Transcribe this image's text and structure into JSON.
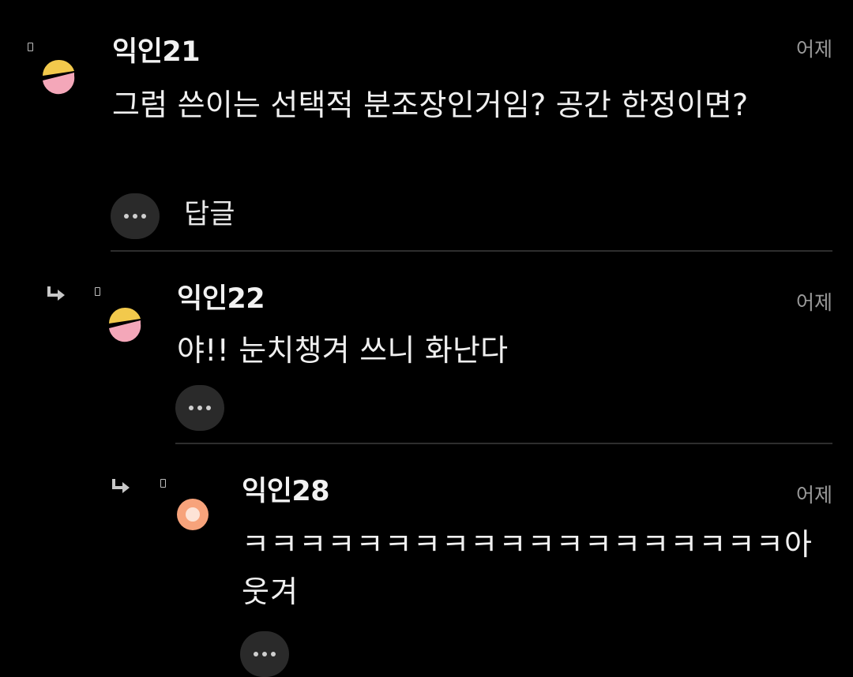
{
  "comments": [
    {
      "author": "익인21",
      "time": "어제",
      "text": "그럼 쓴이는 선택적 분조장인거임? 공간 한정이면?",
      "reply_label": "답글",
      "avatar_icon": "split-circle-yellow-pink"
    },
    {
      "author": "익인22",
      "time": "어제",
      "text": "야!! 눈치챙겨 쓰니 화난다",
      "avatar_icon": "split-circle-yellow-pink"
    },
    {
      "author": "익인28",
      "time": "어제",
      "text": "ㅋㅋㅋㅋㅋㅋㅋㅋㅋㅋㅋㅋㅋㅋㅋㅋㅋㅋㅋ아웃겨",
      "avatar_icon": "orange-ring-circle"
    }
  ],
  "colors": {
    "background": "#000000",
    "avatar_yellow": "#f2c94c",
    "avatar_pink": "#f4a7b9",
    "avatar_orange": "#f7a37b",
    "timestamp": "#9a9a9a",
    "button_bg": "#2a2a2a"
  }
}
